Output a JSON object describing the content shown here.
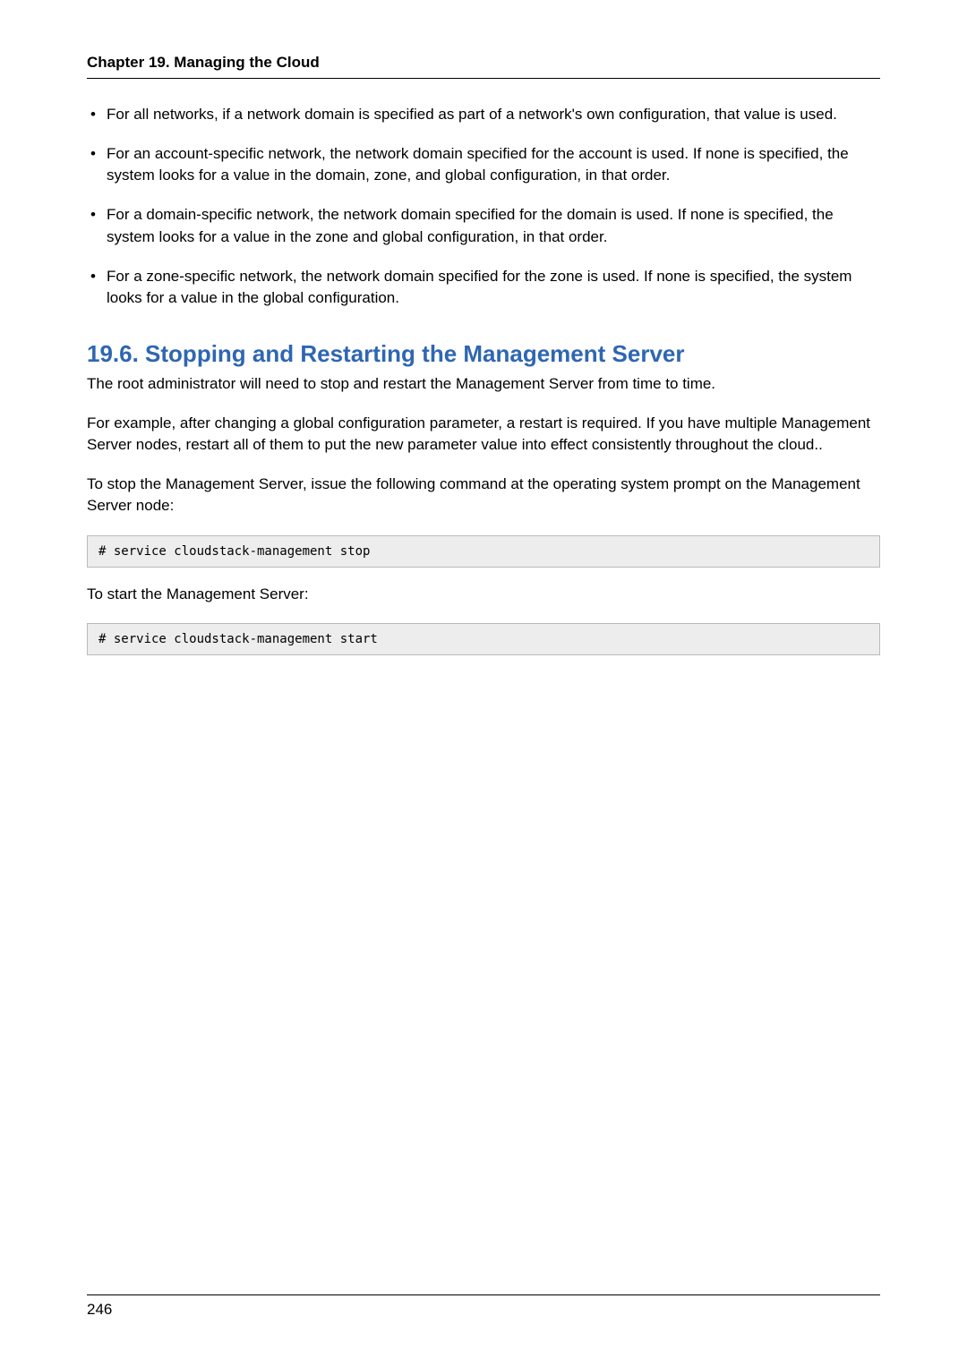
{
  "header": {
    "chapter": "Chapter 19. Managing the Cloud"
  },
  "bullets": [
    "For all networks, if a network domain is specified as part of a network's own configuration, that value is used.",
    "For an account-specific network, the network domain specified for the account is used. If none is specified, the system looks for a value in the domain, zone, and global configuration, in that order.",
    "For a domain-specific network, the network domain specified for the domain is used. If none is specified, the system looks for a value in the zone and global configuration, in that order.",
    "For a zone-specific network, the network domain specified for the zone is used. If none is specified, the system looks for a value in the global configuration."
  ],
  "section": {
    "heading": "19.6. Stopping and Restarting the Management Server",
    "paragraphs": {
      "p1": "The root administrator will need to stop and restart the Management Server from time to time.",
      "p2": "For example, after changing a global configuration parameter, a restart is required. If you have multiple Management Server nodes, restart all of them to put the new parameter value into effect consistently throughout the cloud..",
      "p3": "To stop the Management Server, issue the following command at the operating system prompt on the Management Server node:",
      "p4": "To start the Management Server:"
    },
    "code": {
      "stop": "# service cloudstack-management stop",
      "start": "# service cloudstack-management start"
    }
  },
  "footer": {
    "page_number": "246"
  }
}
